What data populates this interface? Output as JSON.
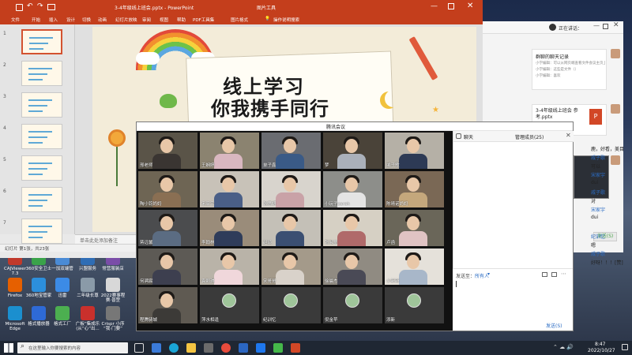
{
  "ppt": {
    "window_title": "3-4年级线上班会.pptx - PowerPoint",
    "context_tab": "图片工具",
    "tabs": [
      "文件",
      "开始",
      "插入",
      "设计",
      "切换",
      "动画",
      "幻灯片放映",
      "审阅",
      "视图",
      "帮助",
      "PDF工具集",
      "图片格式"
    ],
    "tell_me": "操作说明搜索",
    "slide_title_line1": "线上学习",
    "slide_title_line2": "你我携手同行",
    "notes_placeholder": "单击此处添加备注",
    "status": "幻灯片 第1张，共23张",
    "slide_numbers": [
      "1",
      "2",
      "3",
      "4",
      "5",
      "6",
      "7"
    ]
  },
  "meeting": {
    "title": "腾讯会议",
    "tiles": [
      {
        "name": "邢老师",
        "bg": "#5a5448",
        "shirt": "#3a3532"
      },
      {
        "name": "王娴婷",
        "bg": "#8b8370",
        "shirt": "#d9b7c0"
      },
      {
        "name": "单子鑫",
        "bg": "#6a6c71",
        "shirt": "#3a5a86"
      },
      {
        "name": "梦",
        "bg": "#4a4339",
        "shirt": "#aab0ba"
      },
      {
        "name": "戚子歌",
        "bg": "#b5b0a6",
        "shirt": "#2d3a55"
      },
      {
        "name": "陶小钧妈妈",
        "bg": "#6e6554",
        "shirt": "#8a6f53"
      },
      {
        "name": "宋家宇",
        "bg": "#c8c2b8",
        "shirt": "#4a5f87"
      },
      {
        "name": "张思妍",
        "bg": "#d8d4cd",
        "shirt": "#c9a2a7"
      },
      {
        "name": "小玩子sarah",
        "bg": "#8d8e8a",
        "shirt": "#e4e4e4"
      },
      {
        "name": "陈晴诺妈妈",
        "bg": "#7a6855",
        "shirt": "#c4a77c"
      },
      {
        "name": "蒋远馨",
        "bg": "#4b4c4e",
        "shirt": "#5b6c82"
      },
      {
        "name": "李翰林",
        "bg": "#9a8c7a",
        "shirt": "#2f3c5a"
      },
      {
        "name": "赵硕",
        "bg": "#c4c0b7",
        "shirt": "#3b4f72"
      },
      {
        "name": "张淑童",
        "bg": "#d6d0c4",
        "shirt": "#b06a6a"
      },
      {
        "name": "卢函",
        "bg": "#6a6659",
        "shirt": "#e0c3c3"
      },
      {
        "name": "何骋宸",
        "bg": "#5d5a55",
        "shirt": "#3d3f4f"
      },
      {
        "name": "袁颢琪",
        "bg": "#b9b3a8",
        "shirt": "#f0d7db"
      },
      {
        "name": "宋哥哥",
        "bg": "#a49a8a",
        "shirt": "#d9d2ca"
      },
      {
        "name": "徐晨杰",
        "bg": "#908b82",
        "shirt": "#4a4a56"
      },
      {
        "name": "小新新",
        "bg": "#e5e1da",
        "shirt": "#a8b7c9"
      },
      {
        "name": "程腾骑城",
        "bg": "#5f5a52",
        "shirt": "#3c3a37"
      },
      {
        "name": "萍水相逢",
        "bg": "#3a3a3a",
        "shirt": "#ffffff"
      },
      {
        "name": "纪训忆",
        "bg": "#3a3a3a",
        "shirt": "#ffffff"
      },
      {
        "name": "倪金苹",
        "bg": "#3a3a3a",
        "shirt": "#ffffff"
      },
      {
        "name": "添新",
        "bg": "#3a3a3a",
        "shirt": "#ffffff"
      }
    ],
    "chat_tab": "聊天",
    "members_tab": "管理成员(25)",
    "chat_lines": [
      {
        "type": "msg",
        "text": "鹿，好看，美目"
      },
      {
        "type": "user",
        "text": "戚子歌"
      },
      {
        "type": "msg",
        "text": "可以"
      },
      {
        "type": "user",
        "text": "宋家宇"
      },
      {
        "type": "msg",
        "text": "dui"
      },
      {
        "type": "user",
        "text": "戚子歌"
      },
      {
        "type": "msg",
        "text": "对"
      },
      {
        "type": "user",
        "text": "宋家宇"
      },
      {
        "type": "msg",
        "text": "dui"
      },
      {
        "type": "user",
        "text": "纪训忆"
      },
      {
        "type": "msg",
        "text": "嗯"
      },
      {
        "type": "user",
        "text": "戚子歌"
      },
      {
        "type": "msg",
        "text": "好呀！！！[赞]"
      }
    ],
    "send_to_label": "发送至：",
    "send_to_value": "所有人",
    "send_button": "发送(S)"
  },
  "wechat": {
    "title": "正在讲话：",
    "chat_records_title": "群聊的聊天记录",
    "chat_records_preview": "小学编辑：可以从网页端查看文件会议主页上...",
    "chat_records_preview2": "小学编辑：这些是文件（）",
    "chat_records_preview3": "小学编辑：喜欢",
    "file_name": "3-4年级线上班会 参考.pptx",
    "send_button": "发送(S)"
  },
  "desktop_icons": [
    {
      "label": "CAJViewer 7.3",
      "color": "#c0392b"
    },
    {
      "label": "360安全卫士",
      "color": "#3aa34a"
    },
    {
      "label": "一加双端管",
      "color": "#4a8bd6"
    },
    {
      "label": "兴盟服务",
      "color": "#2f6db5"
    },
    {
      "label": "常营服装店",
      "color": "#7a4da8"
    },
    {
      "label": "Firefox",
      "color": "#e66000"
    },
    {
      "label": "360地宝管家",
      "color": "#2c8fdc"
    },
    {
      "label": "迅雷",
      "color": "#3c8be6"
    },
    {
      "label": "二年级长尊",
      "color": "#8a9aa8"
    },
    {
      "label": "2022赛事程 赛·普罡",
      "color": "#d8d8d8"
    },
    {
      "label": "Microsoft Edge",
      "color": "#1b8fcf"
    },
    {
      "label": "格式播放器",
      "color": "#2e6ad6"
    },
    {
      "label": "格式工厂",
      "color": "#4caf50"
    },
    {
      "label": "广板“集成乐 (从“心”出...",
      "color": "#c9302c"
    },
    {
      "label": "Crispr 小序 “我·门要”",
      "color": "#777777"
    }
  ],
  "taskbar": {
    "search_placeholder": "在这里输入你要搜索的内容",
    "time": "8:47",
    "date": "2022/10/27",
    "temp_icon": "weather-icon"
  }
}
